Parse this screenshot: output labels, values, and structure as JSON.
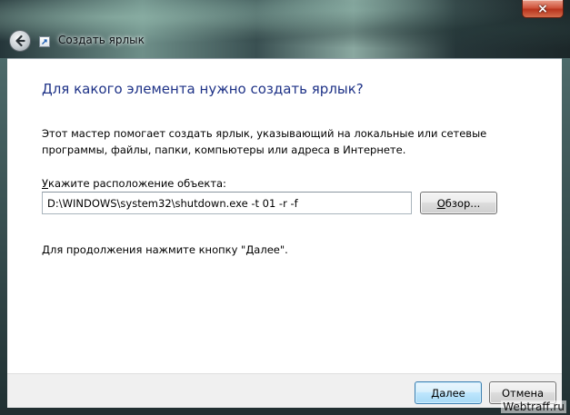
{
  "window": {
    "title": "Создать ярлык",
    "close_label": "×"
  },
  "wizard": {
    "heading": "Для какого элемента нужно создать ярлык?",
    "description": "Этот мастер помогает создать ярлык, указывающий на локальные или сетевые программы, файлы, папки, компьютеры или адреса в Интернете.",
    "location_label_accel": "У",
    "location_label_rest": "кажите расположение объекта:",
    "location_value": "D:\\WINDOWS\\system32\\shutdown.exe -t 01 -r -f",
    "browse_accel": "О",
    "browse_rest": "бзор...",
    "continue_hint": "Для продолжения нажмите кнопку \"Далее\"."
  },
  "footer": {
    "next_accel": "Д",
    "next_rest": "алее",
    "cancel_label": "Отмена"
  },
  "watermark": "Webtraff.ru",
  "icons": {
    "back": "back-arrow-icon",
    "app": "shortcut-icon",
    "close": "close-icon"
  },
  "colors": {
    "heading": "#1e3287",
    "close_button": "#c44a2f",
    "next_button_border": "#3c7fb1"
  }
}
